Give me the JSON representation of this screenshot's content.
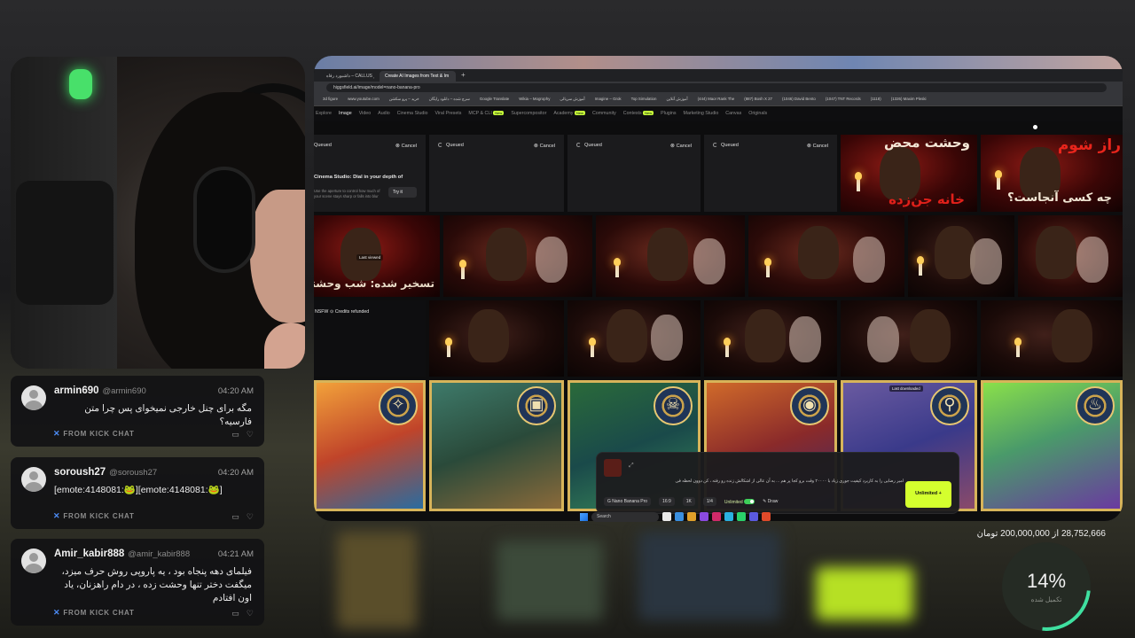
{
  "browser": {
    "tabs": [
      {
        "label": "داشبورد رفاه – CALLUS دفتر"
      },
      {
        "label": "Create AI Images from Text & Im",
        "active": true
      }
    ],
    "new_tab": "+",
    "url": "higgsfield.ai/image/model=nano-banana-pro",
    "bookmarks": [
      "3d figure",
      "www.youtube.com",
      "خرید – پرو سکشن",
      "سرچ شده – دانلود رایگان",
      "Google Translate",
      "Wikia – Mogrophy",
      "آموزش سریالی",
      "Imagine – Grok",
      "Top Simulation",
      "آموزش آنلاین",
      "(444) Maor Rank The",
      "(887) Bosh X 27",
      "(1046) David Bento",
      "(1047) TNT Records",
      "(1118)",
      "(1326) Maxim Pleski"
    ],
    "nav": [
      "Explore",
      "Image",
      "Video",
      "Audio",
      "Cinema Studio",
      "Viral Presets",
      "MCP & CLI",
      "Supercompositor",
      "Academy",
      "Community",
      "Contests",
      "Plugins",
      "Marketing Studio",
      "Canvas",
      "Originals"
    ],
    "nav_active": "Image",
    "nav_new": [
      "MCP & CLI",
      "Academy",
      "Contests"
    ]
  },
  "queue": {
    "cards": [
      {
        "status": "Queued",
        "cancel": "Cancel"
      },
      {
        "status": "Queued",
        "cancel": "Cancel"
      },
      {
        "status": "Queued",
        "cancel": "Cancel"
      },
      {
        "status": "Queued",
        "cancel": "Cancel"
      }
    ],
    "promo_title": "Cinema Studio: Dial in your depth of",
    "promo_text": "Use the aperture to control how much of your scene stays sharp or falls into blur",
    "try_it": "Try it"
  },
  "thumbs": {
    "thumb1_text1": "وحشت محض",
    "thumb1_text2": "خانه جن‌زده",
    "thumb2_text1": "راز شوم",
    "thumb2_text2": "چه کسی آنجاست؟",
    "thumb3_text": "تسخیر شده: شب وحشتناک",
    "last_viewed": "Last viewed",
    "nsfw": "NSFW",
    "credits_refunded": "Credits refunded",
    "last_downloaded": "Last downloaded"
  },
  "composer": {
    "prompt": "امیر رضایی را به کاربرد کیفیت جوری زیاد با ۲۰۰۰۰ وقت برو کجا پر هم ... به آن عالی از اشکالش زنده رو رفته ، کن دوون لحظه فی",
    "model": "Nano Banana Pro",
    "aspect": "16:9",
    "quality": "1K",
    "count": "1/4",
    "unlimited": "Unlimited",
    "draw": "Draw",
    "generate_button": "Unlimited +"
  },
  "taskbar": {
    "search": "Search"
  },
  "chat": [
    {
      "user": "armin690",
      "handle": "@armin690",
      "time": "04:20 AM",
      "message": "مگه برای چنل خارجی نمیخوای پس چرا متن فارسیه؟",
      "rtl": true,
      "footer": "FROM KICK CHAT"
    },
    {
      "user": "soroush27",
      "handle": "@soroush27",
      "time": "04:20 AM",
      "message": "[emote:4148081:🐸][emote:4148081:🐸]",
      "rtl": false,
      "footer": "FROM KICK CHAT"
    },
    {
      "user": "Amir_kabir888",
      "handle": "@amir_kabir888",
      "time": "04:21 AM",
      "message": "فیلمای دهه پنجاه بود ، یه پاروپی روش حرف میزد، میگفت دختر تنها وحشت زده ، در دام راهزنان، یاد اون افتادم",
      "rtl": true,
      "footer": "FROM KICK CHAT"
    }
  ],
  "donation": {
    "text": "28,752,666 از 200,000,000 تومان",
    "progress_pct": 14,
    "progress_label": "14%",
    "progress_caption": "تکمیل شده"
  },
  "colors": {
    "accent_lime": "#d4ff2e",
    "kick_green": "#48e06a",
    "progress_teal": "#3fe0a0"
  }
}
